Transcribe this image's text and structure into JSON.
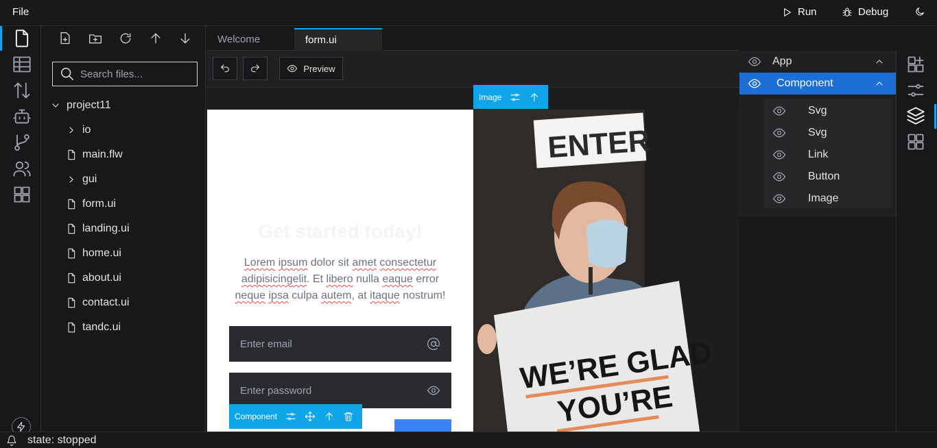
{
  "menu": {
    "file": "File"
  },
  "topbar": {
    "run_label": "Run",
    "debug_label": "Debug"
  },
  "activity_bar": {
    "items": [
      "file-icon",
      "table-icon",
      "sort-arrows-icon",
      "robot-icon",
      "git-branch-icon",
      "users-icon",
      "components-icon"
    ],
    "active": "file-icon"
  },
  "explorer": {
    "search_placeholder": "Search files...",
    "project": "project11",
    "tree": [
      {
        "label": "io",
        "type": "folder"
      },
      {
        "label": "main.flw",
        "type": "file"
      },
      {
        "label": "gui",
        "type": "folder"
      },
      {
        "label": "form.ui",
        "type": "file"
      },
      {
        "label": "landing.ui",
        "type": "file"
      },
      {
        "label": "home.ui",
        "type": "file"
      },
      {
        "label": "about.ui",
        "type": "file"
      },
      {
        "label": "contact.ui",
        "type": "file"
      },
      {
        "label": "tandc.ui",
        "type": "file"
      }
    ]
  },
  "tabs": [
    {
      "label": "Welcome",
      "active": false
    },
    {
      "label": "form.ui",
      "active": true
    }
  ],
  "canvas_toolbar": {
    "preview_label": "Preview"
  },
  "page": {
    "title": "Get started today!",
    "body_words": [
      "Lorem",
      "ipsum",
      "dolor sit",
      "amet",
      "consectetur",
      "adipisicing",
      "elit",
      ". Et",
      "libero",
      "nulla",
      "eaque",
      "error",
      "neque",
      "ipsa",
      "culpa",
      "autem",
      ", at",
      "itaque",
      "nostrum!"
    ],
    "email_placeholder": "Enter email",
    "password_placeholder": "Enter password"
  },
  "selection": {
    "image_chip": "Image",
    "component_chip": "Component"
  },
  "layers": {
    "app": "App",
    "component": "Component",
    "children": [
      "Svg",
      "Svg",
      "Link",
      "Button",
      "Image"
    ]
  },
  "photo_sign": {
    "line1": "WE’RE GLAD",
    "line2": "YOU’RE",
    "door_sign": "ENTER"
  },
  "status": {
    "text": "state: stopped"
  },
  "colors": {
    "accent": "#0ea5e9",
    "selection": "#1d6fd6",
    "background": "#18181b"
  }
}
